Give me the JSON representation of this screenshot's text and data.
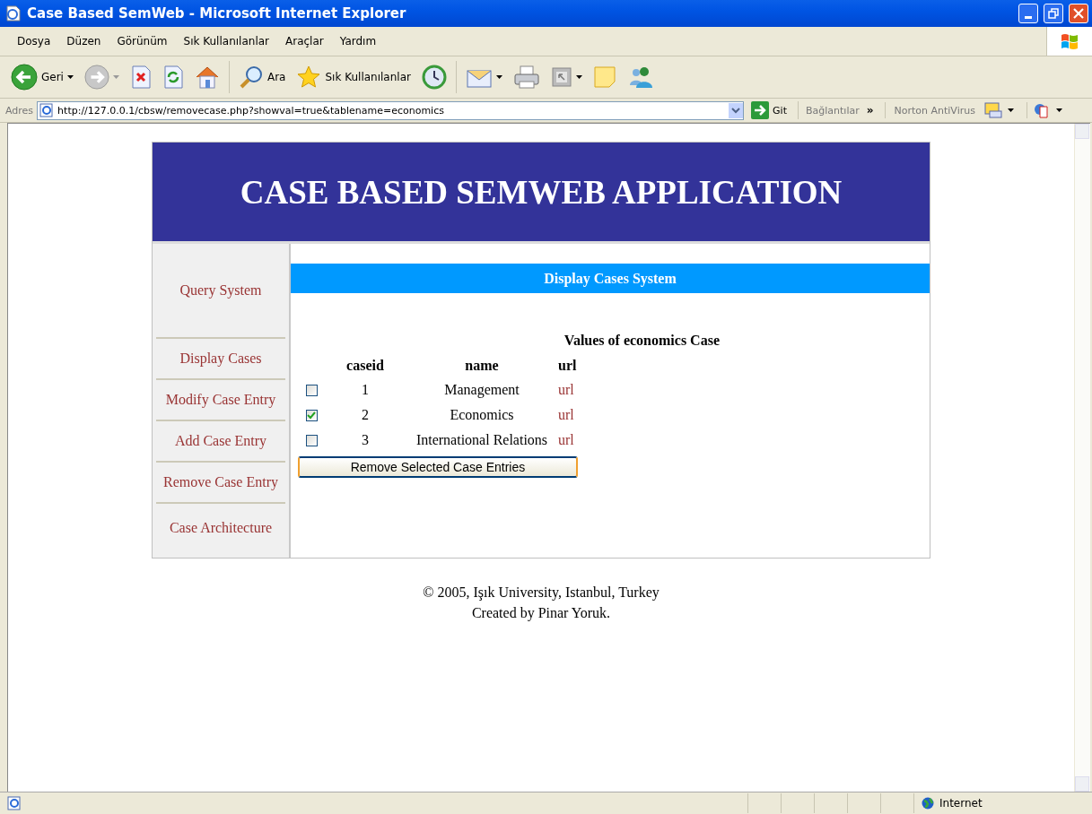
{
  "window": {
    "title": "Case Based SemWeb - Microsoft Internet Explorer"
  },
  "menu": [
    "Dosya",
    "Düzen",
    "Görünüm",
    "Sık Kullanılanlar",
    "Araçlar",
    "Yardım"
  ],
  "toolbar": [
    {
      "kind": "back",
      "label": "Geri",
      "dropdown": true
    },
    {
      "kind": "forward",
      "dropdown": true
    },
    {
      "kind": "stop"
    },
    {
      "kind": "refresh"
    },
    {
      "kind": "home"
    },
    {
      "kind": "search",
      "label": "Ara"
    },
    {
      "kind": "favorites",
      "label": "Sık Kullanılanlar"
    },
    {
      "kind": "history"
    },
    {
      "kind": "mail",
      "dropdown": true
    },
    {
      "kind": "print"
    },
    {
      "kind": "edit",
      "dropdown": true
    },
    {
      "kind": "note"
    },
    {
      "kind": "messenger"
    }
  ],
  "address": {
    "label": "Adres",
    "url": "http://127.0.0.1/cbsw/removecase.php?showval=true&tablename=economics",
    "go": "Git",
    "links": "Bağlantılar",
    "chevron": "»",
    "norton": "Norton AntiVirus"
  },
  "page": {
    "header": "CASE BASED SEMWEB APPLICATION",
    "sidebar": [
      "Query System",
      "Display Cases",
      "Modify Case Entry",
      "Add Case Entry",
      "Remove Case Entry",
      "Case Architecture"
    ],
    "section_title": "Display Cases System",
    "table": {
      "caption": "Values of economics Case",
      "columns": [
        "caseid",
        "name",
        "url"
      ],
      "rows": [
        {
          "checked": false,
          "caseid": "1",
          "name": "Management",
          "url": "url"
        },
        {
          "checked": true,
          "caseid": "2",
          "name": "Economics",
          "url": "url"
        },
        {
          "checked": false,
          "caseid": "3",
          "name": "International Relations",
          "url": "url"
        }
      ]
    },
    "button": "Remove Selected Case Entries",
    "footer": [
      "© 2005, Işık University, Istanbul, Turkey",
      "Created by Pinar Yoruk."
    ]
  },
  "status_bar": {
    "zone": "Internet"
  }
}
